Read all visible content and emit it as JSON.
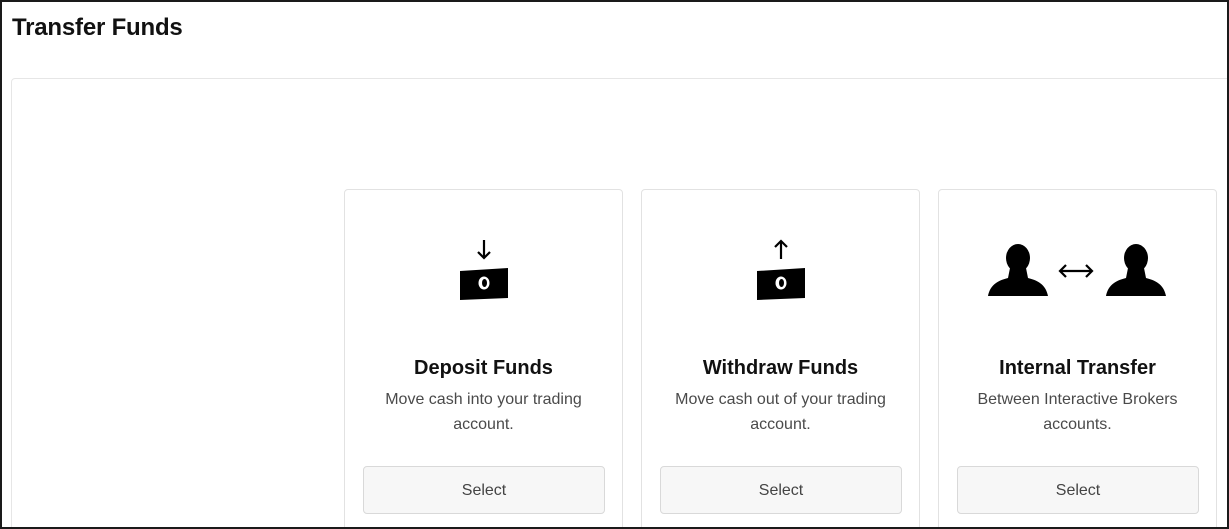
{
  "header": {
    "title": "Transfer Funds"
  },
  "cards": [
    {
      "title": "Deposit Funds",
      "description": "Move cash into your trading account.",
      "button_label": "Select",
      "icon": "cash-deposit-icon"
    },
    {
      "title": "Withdraw Funds",
      "description": "Move cash out of your trading account.",
      "button_label": "Select",
      "icon": "cash-withdraw-icon"
    },
    {
      "title": "Internal Transfer",
      "description": "Between Interactive Brokers accounts.",
      "button_label": "Select",
      "icon": "user-transfer-icon"
    }
  ],
  "colors": {
    "text": "#111111",
    "muted_text": "#4a4a4a",
    "button_bg": "#f7f7f7",
    "border": "#e2e2e2"
  }
}
